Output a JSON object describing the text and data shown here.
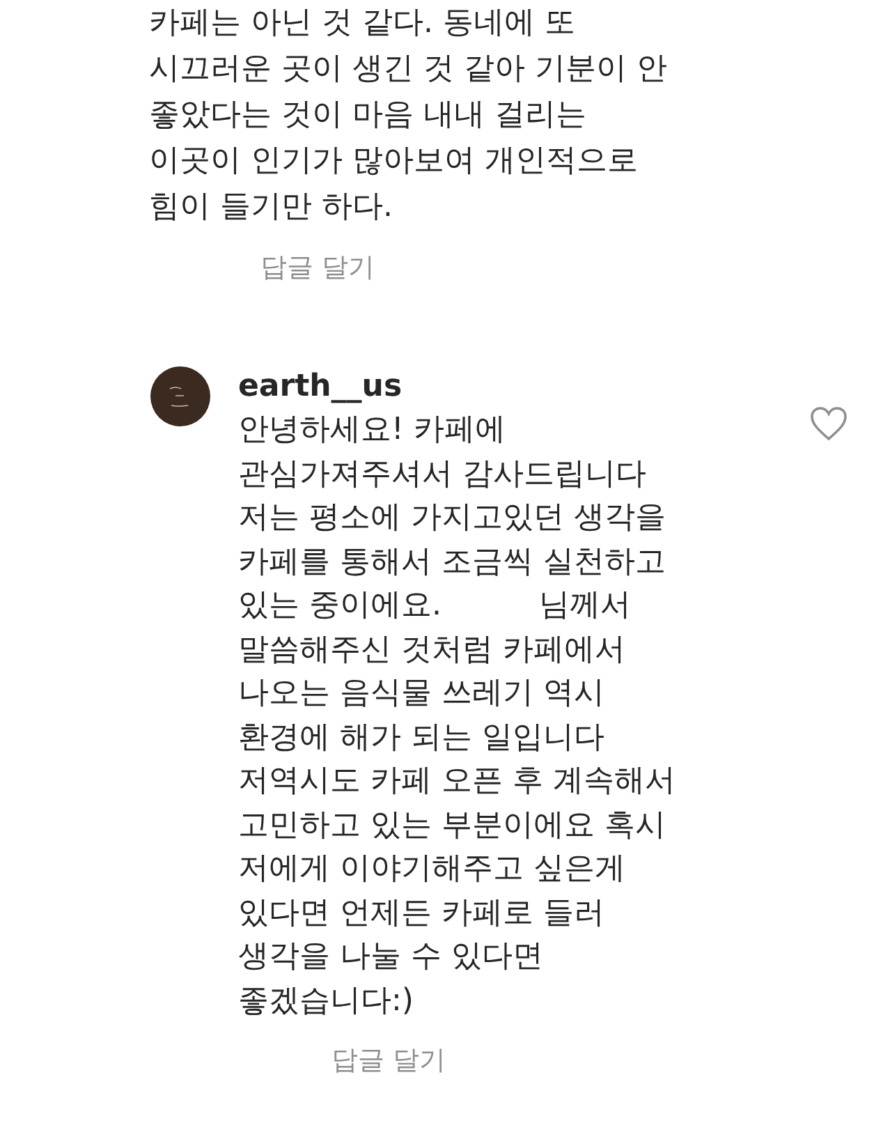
{
  "comments": [
    {
      "kind": "reply",
      "text": "카페는 아닌 것 같다. 동네에 또\n시끄러운 곳이 생긴 것 같아 기분이 안\n좋았다는 것이 마음 내내 걸리는\n이곳이 인기가 많아보여 개인적으로\n힘이 들기만 하다.",
      "reply_label": "답글 달기"
    },
    {
      "kind": "comment",
      "username": "earth__us",
      "text": "안녕하세요! 카페에\n관심가져주셔서 감사드립니다\n저는 평소에 가지고있던 생각을\n카페를 통해서 조금씩 실천하고\n있는 중이에요.          님께서\n말씀해주신 것처럼 카페에서\n나오는 음식물 쓰레기 역시\n환경에 해가 되는 일입니다\n저역시도 카페 오픈 후 계속해서\n고민하고 있는 부분이에요 혹시\n저에게 이야기해주고 싶은게\n있다면 언제든 카페로 들러\n생각을 나눌 수 있다면\n좋겠습니다:)",
      "reply_label": "답글 달기",
      "liked": false
    }
  ]
}
